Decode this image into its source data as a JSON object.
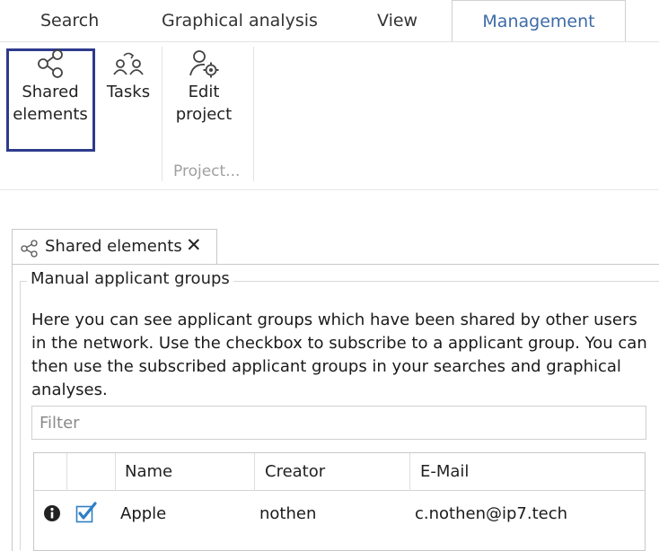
{
  "ribbon": {
    "tabs": [
      {
        "label": "Search"
      },
      {
        "label": "Graphical analysis"
      },
      {
        "label": "View"
      },
      {
        "label": "Management",
        "active": true
      }
    ],
    "buttons": {
      "shared_elements": {
        "line1": "Shared",
        "line2": "elements",
        "icon": "share-icon"
      },
      "tasks": {
        "label": "Tasks",
        "icon": "tasks-icon"
      },
      "edit_project": {
        "line1": "Edit",
        "line2": "project",
        "icon": "user-gear-icon"
      }
    },
    "group_label": "Project..."
  },
  "document_tab": {
    "label": "Shared elements",
    "close": "✕",
    "icon": "share-icon"
  },
  "manual_groups": {
    "title": "Manual applicant groups",
    "description": "Here you can see applicant groups which have been shared by other users in the network. Use the checkbox to subscribe to a applicant group. You can then use the subscribed applicant groups in your searches and graphical analyses.",
    "filter_placeholder": "Filter",
    "columns": [
      "Name",
      "Creator",
      "E-Mail"
    ],
    "rows": [
      {
        "name": "Apple",
        "creator": "nothen",
        "email": "c.nothen@ip7.tech",
        "subscribed": true
      }
    ]
  },
  "colors": {
    "accent": "#3d6ba8",
    "selection_frame": "#2d3a8c",
    "checkbox": "#2f7fc4"
  }
}
